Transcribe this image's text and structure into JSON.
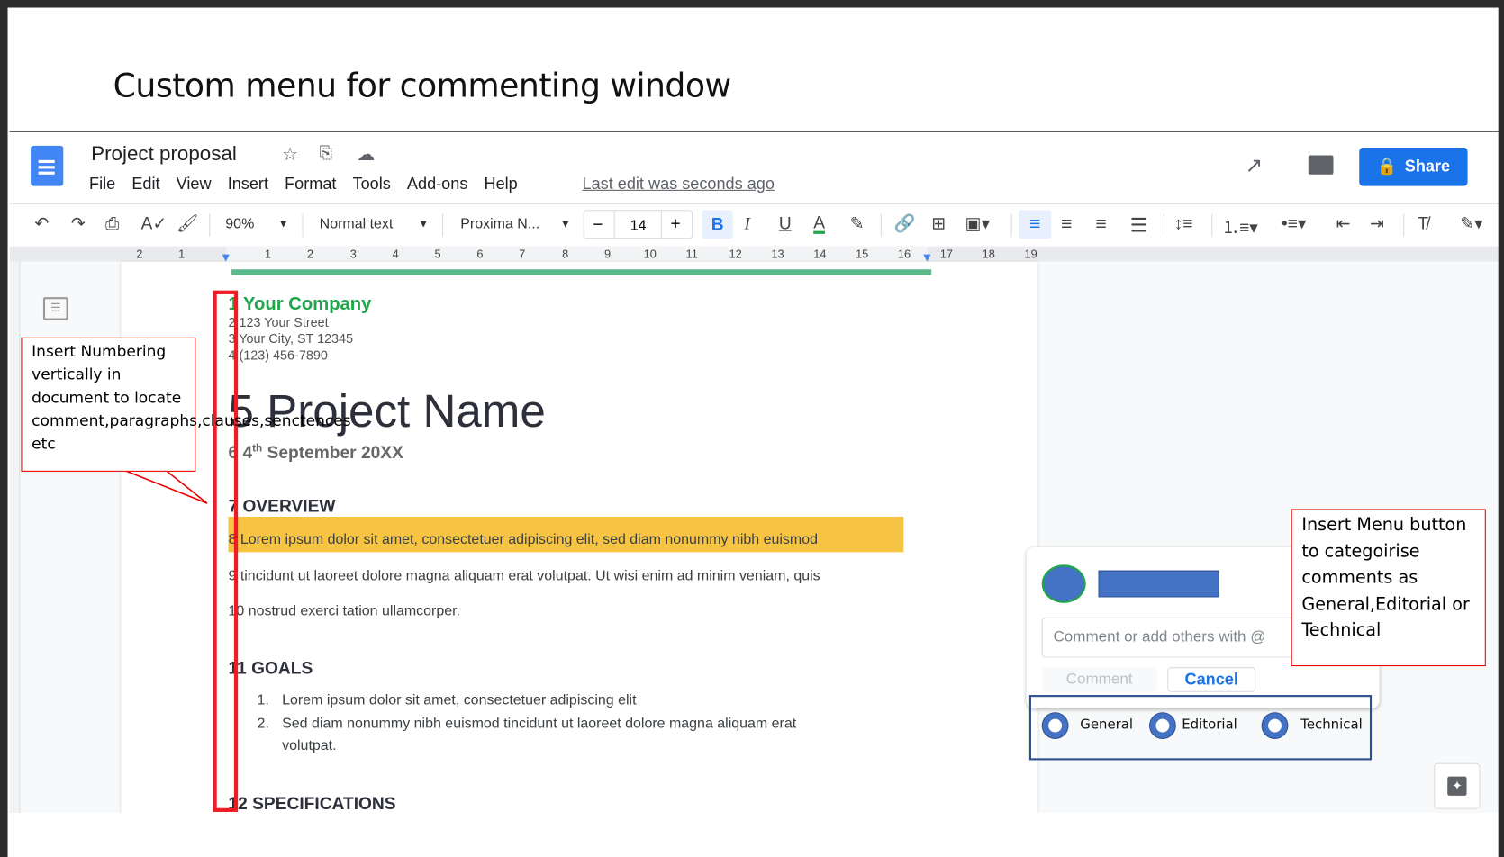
{
  "slide_title": "Custom menu for commenting window",
  "docs": {
    "title": "Project proposal",
    "menu": [
      "File",
      "Edit",
      "View",
      "Insert",
      "Format",
      "Tools",
      "Add-ons",
      "Help"
    ],
    "last_edit": "Last edit was seconds ago",
    "share_label": "Share",
    "toolbar": {
      "zoom": "90%",
      "style": "Normal text",
      "font": "Proxima N...",
      "font_size": "14",
      "bold": "B",
      "italic": "I",
      "underline": "U",
      "text_color": "A"
    },
    "ruler": [
      "2",
      "1",
      "1",
      "2",
      "3",
      "4",
      "5",
      "6",
      "7",
      "8",
      "9",
      "10",
      "11",
      "12",
      "13",
      "14",
      "15",
      "16",
      "17",
      "18",
      "19"
    ]
  },
  "document": {
    "company": "1 Your Company",
    "address": [
      "2 123 Your Street",
      "3 Your City, ST 12345",
      "4 (123) 456-7890"
    ],
    "project_name": "5 Project Name",
    "date_prefix": "6 4",
    "date_sup": "th",
    "date_rest": " September 20XX",
    "overview": "7 OVERVIEW",
    "para": [
      "8 Lorem ipsum dolor sit amet, consectetuer adipiscing elit, sed diam nonummy nibh euismod",
      "9 tincidunt ut laoreet dolore magna aliquam erat volutpat. Ut wisi enim ad minim veniam, quis",
      "10 nostrud exerci tation ullamcorper."
    ],
    "goals": "11 GOALS",
    "goal_items": [
      {
        "num": "1.",
        "text": "Lorem ipsum dolor sit amet, consectetuer adipiscing elit"
      },
      {
        "num": "2.",
        "text": "Sed diam nonummy nibh euismod tincidunt ut laoreet dolore magna aliquam erat"
      },
      {
        "num": "",
        "text": "volutpat."
      }
    ],
    "specs": "12 SPECIFICATIONS",
    "highlight_color": "#f6c343"
  },
  "comment_box": {
    "placeholder": "Comment or add others with @",
    "comment_label": "Comment",
    "cancel_label": "Cancel",
    "categories": [
      "General",
      "Editorial",
      "Technical"
    ]
  },
  "annotations": {
    "left": "Insert Numbering vertically in document to locate comment,paragraphs,clauses,senctences etc",
    "right": "Insert Menu button to categoirise comments as General,Editorial or Technical"
  },
  "colors": {
    "accent": "#1a73e8",
    "annotation": "#ee1c25",
    "category_box": "#2f528f"
  }
}
